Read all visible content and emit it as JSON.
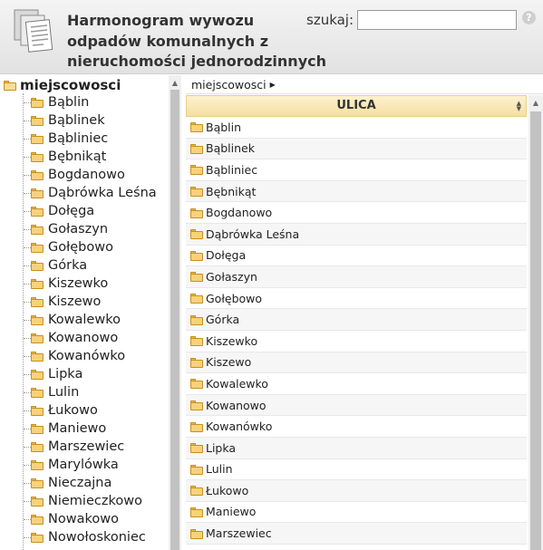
{
  "header": {
    "title": "Harmonogram wywozu odpadów komunalnych z nieruchomości jednorodzinnych",
    "search_label": "szukaj:",
    "search_value": "",
    "help_glyph": "?"
  },
  "tree": {
    "root_label": "miejscowosci",
    "items": [
      "Bąblin",
      "Bąblinek",
      "Bąbliniec",
      "Bębnikąt",
      "Bogdanowo",
      "Dąbrówka Leśna",
      "Dołęga",
      "Gołaszyn",
      "Gołębowo",
      "Górka",
      "Kiszewko",
      "Kiszewo",
      "Kowalewko",
      "Kowanowo",
      "Kowanówko",
      "Lipka",
      "Lulin",
      "Łukowo",
      "Maniewo",
      "Marszewiec",
      "Marylówka",
      "Nieczajna",
      "Niemieczkowo",
      "Nowakowo",
      "Nowołoskoniec"
    ]
  },
  "breadcrumb": {
    "label": "miejscowosci"
  },
  "table": {
    "column_header": "ULICA",
    "rows": [
      "Bąblin",
      "Bąblinek",
      "Bąbliniec",
      "Bębnikąt",
      "Bogdanowo",
      "Dąbrówka Leśna",
      "Dołęga",
      "Gołaszyn",
      "Gołębowo",
      "Górka",
      "Kiszewko",
      "Kiszewo",
      "Kowalewko",
      "Kowanowo",
      "Kowanówko",
      "Lipka",
      "Lulin",
      "Łukowo",
      "Maniewo",
      "Marszewiec"
    ]
  },
  "icons": {
    "folder": "folder-icon",
    "open_folder": "folder-open-icon",
    "help": "help-icon",
    "sort": "sort-icon",
    "document": "documents-icon"
  },
  "colors": {
    "header_bg": "#e8e8e8",
    "column_header_bg": "#f8e6b0",
    "folder": "#f7d27a"
  }
}
